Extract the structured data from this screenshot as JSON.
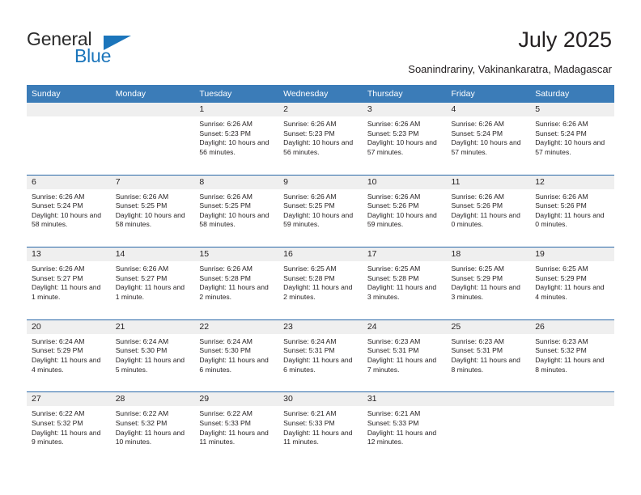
{
  "brand": {
    "name_part1": "General",
    "name_part2": "Blue",
    "triangle_icon": "blue-triangle-icon",
    "colors": {
      "dark": "#2b2b2b",
      "blue": "#1b75bb"
    }
  },
  "header": {
    "title": "July 2025",
    "subtitle": "Soanindrariny, Vakinankaratra, Madagascar"
  },
  "calendar": {
    "colors": {
      "header_bg": "#3b7cb8",
      "header_text": "#ffffff",
      "date_band_bg": "#efefef",
      "row_rule": "#2a68a8",
      "cell_bg": "#ffffff",
      "text": "#231f20"
    },
    "weekday_headers": [
      "Sunday",
      "Monday",
      "Tuesday",
      "Wednesday",
      "Thursday",
      "Friday",
      "Saturday"
    ],
    "weeks": [
      [
        {
          "day": "",
          "sunrise": "",
          "sunset": "",
          "daylight": ""
        },
        {
          "day": "",
          "sunrise": "",
          "sunset": "",
          "daylight": ""
        },
        {
          "day": "1",
          "sunrise": "Sunrise: 6:26 AM",
          "sunset": "Sunset: 5:23 PM",
          "daylight": "Daylight: 10 hours and 56 minutes."
        },
        {
          "day": "2",
          "sunrise": "Sunrise: 6:26 AM",
          "sunset": "Sunset: 5:23 PM",
          "daylight": "Daylight: 10 hours and 56 minutes."
        },
        {
          "day": "3",
          "sunrise": "Sunrise: 6:26 AM",
          "sunset": "Sunset: 5:23 PM",
          "daylight": "Daylight: 10 hours and 57 minutes."
        },
        {
          "day": "4",
          "sunrise": "Sunrise: 6:26 AM",
          "sunset": "Sunset: 5:24 PM",
          "daylight": "Daylight: 10 hours and 57 minutes."
        },
        {
          "day": "5",
          "sunrise": "Sunrise: 6:26 AM",
          "sunset": "Sunset: 5:24 PM",
          "daylight": "Daylight: 10 hours and 57 minutes."
        }
      ],
      [
        {
          "day": "6",
          "sunrise": "Sunrise: 6:26 AM",
          "sunset": "Sunset: 5:24 PM",
          "daylight": "Daylight: 10 hours and 58 minutes."
        },
        {
          "day": "7",
          "sunrise": "Sunrise: 6:26 AM",
          "sunset": "Sunset: 5:25 PM",
          "daylight": "Daylight: 10 hours and 58 minutes."
        },
        {
          "day": "8",
          "sunrise": "Sunrise: 6:26 AM",
          "sunset": "Sunset: 5:25 PM",
          "daylight": "Daylight: 10 hours and 58 minutes."
        },
        {
          "day": "9",
          "sunrise": "Sunrise: 6:26 AM",
          "sunset": "Sunset: 5:25 PM",
          "daylight": "Daylight: 10 hours and 59 minutes."
        },
        {
          "day": "10",
          "sunrise": "Sunrise: 6:26 AM",
          "sunset": "Sunset: 5:26 PM",
          "daylight": "Daylight: 10 hours and 59 minutes."
        },
        {
          "day": "11",
          "sunrise": "Sunrise: 6:26 AM",
          "sunset": "Sunset: 5:26 PM",
          "daylight": "Daylight: 11 hours and 0 minutes."
        },
        {
          "day": "12",
          "sunrise": "Sunrise: 6:26 AM",
          "sunset": "Sunset: 5:26 PM",
          "daylight": "Daylight: 11 hours and 0 minutes."
        }
      ],
      [
        {
          "day": "13",
          "sunrise": "Sunrise: 6:26 AM",
          "sunset": "Sunset: 5:27 PM",
          "daylight": "Daylight: 11 hours and 1 minute."
        },
        {
          "day": "14",
          "sunrise": "Sunrise: 6:26 AM",
          "sunset": "Sunset: 5:27 PM",
          "daylight": "Daylight: 11 hours and 1 minute."
        },
        {
          "day": "15",
          "sunrise": "Sunrise: 6:26 AM",
          "sunset": "Sunset: 5:28 PM",
          "daylight": "Daylight: 11 hours and 2 minutes."
        },
        {
          "day": "16",
          "sunrise": "Sunrise: 6:25 AM",
          "sunset": "Sunset: 5:28 PM",
          "daylight": "Daylight: 11 hours and 2 minutes."
        },
        {
          "day": "17",
          "sunrise": "Sunrise: 6:25 AM",
          "sunset": "Sunset: 5:28 PM",
          "daylight": "Daylight: 11 hours and 3 minutes."
        },
        {
          "day": "18",
          "sunrise": "Sunrise: 6:25 AM",
          "sunset": "Sunset: 5:29 PM",
          "daylight": "Daylight: 11 hours and 3 minutes."
        },
        {
          "day": "19",
          "sunrise": "Sunrise: 6:25 AM",
          "sunset": "Sunset: 5:29 PM",
          "daylight": "Daylight: 11 hours and 4 minutes."
        }
      ],
      [
        {
          "day": "20",
          "sunrise": "Sunrise: 6:24 AM",
          "sunset": "Sunset: 5:29 PM",
          "daylight": "Daylight: 11 hours and 4 minutes."
        },
        {
          "day": "21",
          "sunrise": "Sunrise: 6:24 AM",
          "sunset": "Sunset: 5:30 PM",
          "daylight": "Daylight: 11 hours and 5 minutes."
        },
        {
          "day": "22",
          "sunrise": "Sunrise: 6:24 AM",
          "sunset": "Sunset: 5:30 PM",
          "daylight": "Daylight: 11 hours and 6 minutes."
        },
        {
          "day": "23",
          "sunrise": "Sunrise: 6:24 AM",
          "sunset": "Sunset: 5:31 PM",
          "daylight": "Daylight: 11 hours and 6 minutes."
        },
        {
          "day": "24",
          "sunrise": "Sunrise: 6:23 AM",
          "sunset": "Sunset: 5:31 PM",
          "daylight": "Daylight: 11 hours and 7 minutes."
        },
        {
          "day": "25",
          "sunrise": "Sunrise: 6:23 AM",
          "sunset": "Sunset: 5:31 PM",
          "daylight": "Daylight: 11 hours and 8 minutes."
        },
        {
          "day": "26",
          "sunrise": "Sunrise: 6:23 AM",
          "sunset": "Sunset: 5:32 PM",
          "daylight": "Daylight: 11 hours and 8 minutes."
        }
      ],
      [
        {
          "day": "27",
          "sunrise": "Sunrise: 6:22 AM",
          "sunset": "Sunset: 5:32 PM",
          "daylight": "Daylight: 11 hours and 9 minutes."
        },
        {
          "day": "28",
          "sunrise": "Sunrise: 6:22 AM",
          "sunset": "Sunset: 5:32 PM",
          "daylight": "Daylight: 11 hours and 10 minutes."
        },
        {
          "day": "29",
          "sunrise": "Sunrise: 6:22 AM",
          "sunset": "Sunset: 5:33 PM",
          "daylight": "Daylight: 11 hours and 11 minutes."
        },
        {
          "day": "30",
          "sunrise": "Sunrise: 6:21 AM",
          "sunset": "Sunset: 5:33 PM",
          "daylight": "Daylight: 11 hours and 11 minutes."
        },
        {
          "day": "31",
          "sunrise": "Sunrise: 6:21 AM",
          "sunset": "Sunset: 5:33 PM",
          "daylight": "Daylight: 11 hours and 12 minutes."
        },
        {
          "day": "",
          "sunrise": "",
          "sunset": "",
          "daylight": ""
        },
        {
          "day": "",
          "sunrise": "",
          "sunset": "",
          "daylight": ""
        }
      ]
    ]
  }
}
